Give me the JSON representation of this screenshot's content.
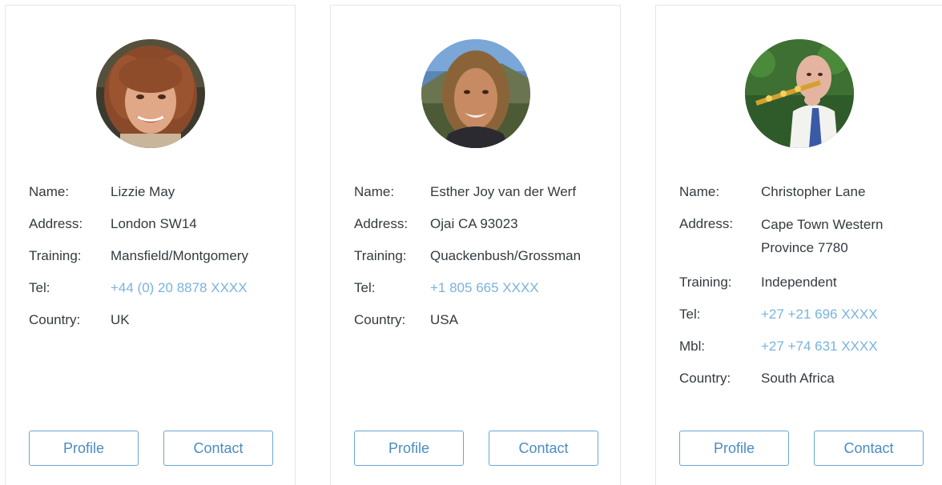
{
  "members": [
    {
      "avatar": "portrait-woman-curly-hair",
      "fields": [
        {
          "label": "Name:",
          "value": "Lizzie May"
        },
        {
          "label": "Address:",
          "value": "London SW14"
        },
        {
          "label": "Training:",
          "value": "Mansfield/Montgomery"
        },
        {
          "label": "Tel:",
          "value": "+44 (0) 20 8878 XXXX"
        },
        {
          "label": "Country:",
          "value": "UK"
        }
      ],
      "profile_label": "Profile",
      "contact_label": "Contact"
    },
    {
      "avatar": "portrait-woman-outdoors",
      "fields": [
        {
          "label": "Name:",
          "value": "Esther Joy van der Werf"
        },
        {
          "label": "Address:",
          "value": "Ojai CA 93023"
        },
        {
          "label": "Training:",
          "value": "Quackenbush/Grossman"
        },
        {
          "label": "Tel:",
          "value": "+1 805 665 XXXX"
        },
        {
          "label": "Country:",
          "value": "USA"
        }
      ],
      "profile_label": "Profile",
      "contact_label": "Contact"
    },
    {
      "avatar": "portrait-man-holding-device",
      "fields": [
        {
          "label": "Name:",
          "value": "Christopher Lane"
        },
        {
          "label": "Address:",
          "value": "Cape Town Western Province 7780"
        },
        {
          "label": "Training:",
          "value": "Independent"
        },
        {
          "label": "Tel:",
          "value": "+27 +21 696 XXXX"
        },
        {
          "label": "Mbl:",
          "value": "+27 +74 631 XXXX"
        },
        {
          "label": "Country:",
          "value": "South Africa"
        }
      ],
      "profile_label": "Profile",
      "contact_label": "Contact"
    }
  ],
  "colors": {
    "link": "#7ab3dd",
    "button_border": "#6aa6d3",
    "button_text": "#4a8cc4",
    "text": "#333b40",
    "card_border": "#e3e7ea"
  }
}
